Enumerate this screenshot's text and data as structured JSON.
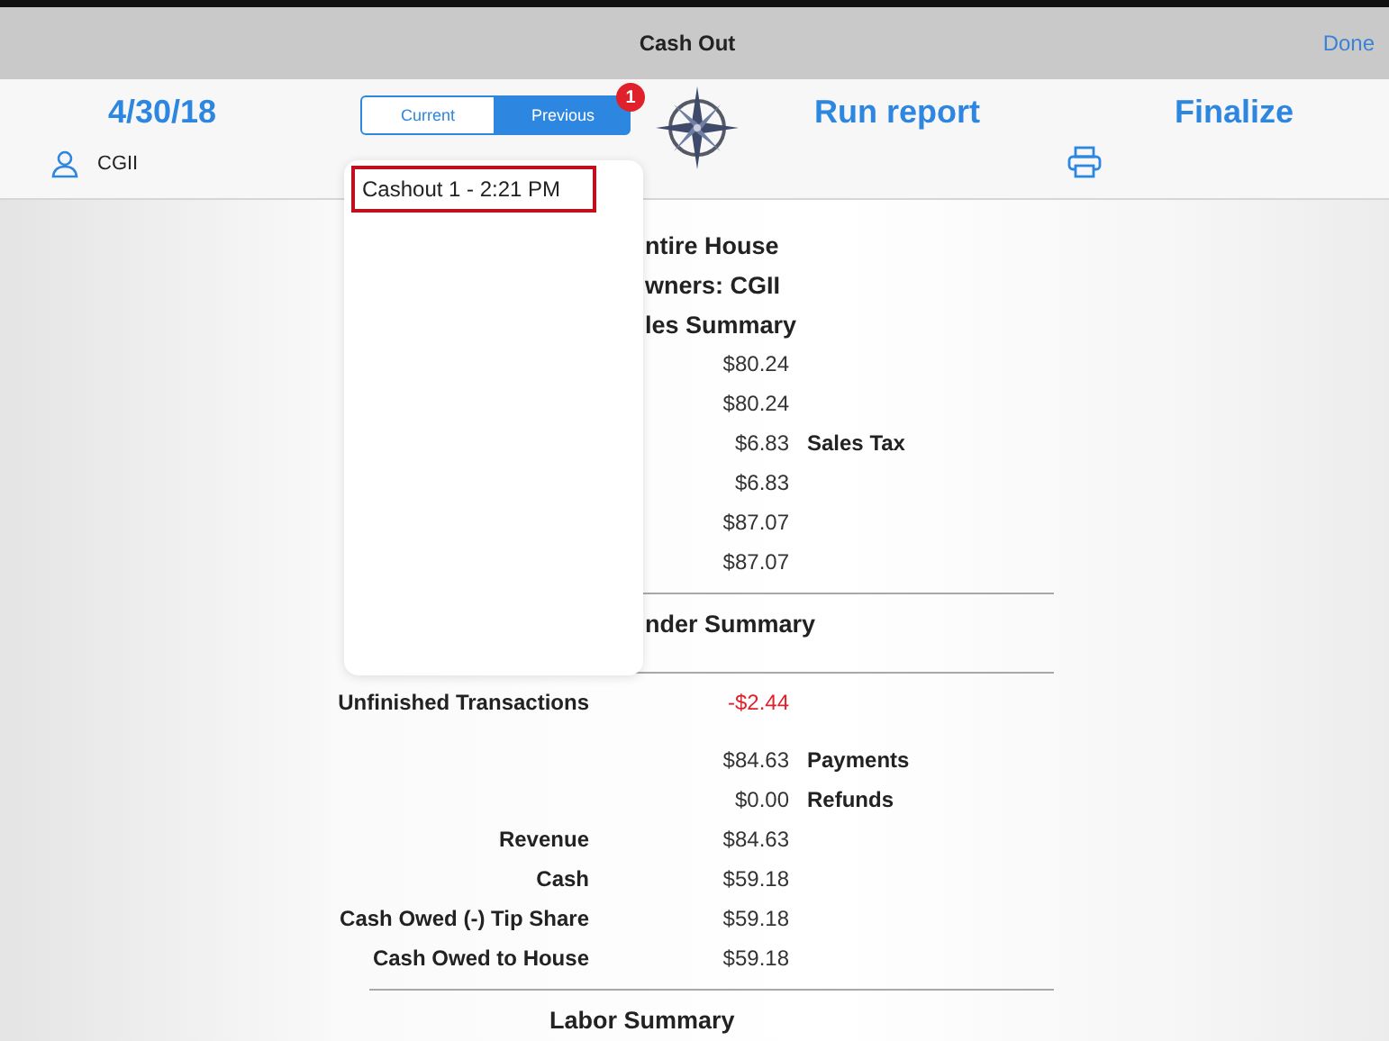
{
  "nav_bar": {
    "title": "Cash Out",
    "done": "Done"
  },
  "header": {
    "date": "4/30/18",
    "user": "CGII",
    "run_report": "Run report",
    "finalize": "Finalize"
  },
  "segments": [
    {
      "label": "Current",
      "selected": false
    },
    {
      "label": "Previous",
      "selected": true,
      "badge": "1"
    }
  ],
  "popover": {
    "items": [
      {
        "label": "Cashout 1 - 2:21 PM",
        "highlighted": true
      }
    ]
  },
  "report": {
    "rows": [
      {
        "kind": "heading",
        "text": "ntire House"
      },
      {
        "kind": "heading",
        "text": "wners: CGII"
      },
      {
        "kind": "heading",
        "text": "les Summary"
      },
      {
        "kind": "amount",
        "value": "$80.24",
        "negative": false
      },
      {
        "kind": "amount",
        "value": "$80.24",
        "negative": false
      },
      {
        "kind": "amount",
        "value": "$6.83",
        "note": "Sales Tax",
        "negative": false
      },
      {
        "kind": "amount",
        "value": "$6.83",
        "negative": false
      },
      {
        "kind": "amount",
        "value": "$87.07",
        "negative": false
      },
      {
        "kind": "amount",
        "value": "$87.07",
        "negative": false
      },
      {
        "kind": "divider"
      },
      {
        "kind": "heading",
        "text": "nder Summary"
      },
      {
        "kind": "spacer"
      },
      {
        "kind": "divider"
      },
      {
        "kind": "amount",
        "label": "Unfinished Transactions",
        "value": "-$2.44",
        "negative": true
      },
      {
        "kind": "spacer"
      },
      {
        "kind": "amount",
        "value": "$84.63",
        "note": "Payments",
        "negative": false
      },
      {
        "kind": "amount",
        "value": "$0.00",
        "note": "Refunds",
        "negative": false
      },
      {
        "kind": "amount",
        "label": "Revenue",
        "value": "$84.63",
        "negative": false
      },
      {
        "kind": "amount",
        "label": "Cash",
        "value": "$59.18",
        "negative": false
      },
      {
        "kind": "amount",
        "label": "Cash Owed (-) Tip Share",
        "value": "$59.18",
        "negative": false
      },
      {
        "kind": "amount",
        "label": "Cash Owed to House",
        "value": "$59.18",
        "negative": false
      },
      {
        "kind": "divider"
      },
      {
        "kind": "centered_heading",
        "text": "Labor Summary"
      }
    ]
  }
}
